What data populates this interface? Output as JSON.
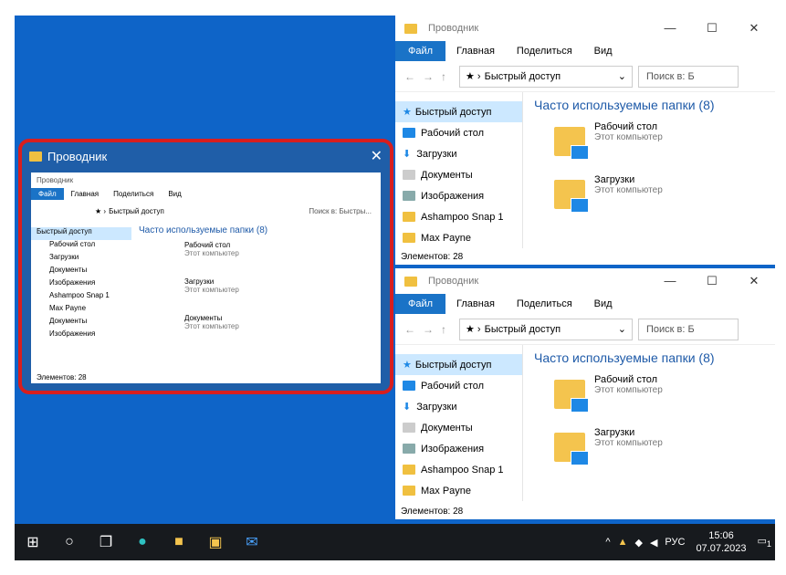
{
  "explorer": {
    "title": "Проводник",
    "ribbon": [
      "Файл",
      "Главная",
      "Поделиться",
      "Вид"
    ],
    "address": "Быстрый доступ",
    "search_placeholder": "Поиск в: Быстрый доступ",
    "search_short": "Поиск в: Б",
    "search_small": "Поиск в: Быстры...",
    "sidebar": [
      "Быстрый доступ",
      "Рабочий стол",
      "Загрузки",
      "Документы",
      "Изображения",
      "Ashampoo Snap 1",
      "Max Payne",
      "Документы",
      "Изображения"
    ],
    "group": "Часто используемые папки (8)",
    "items": [
      {
        "name": "Рабочий стол",
        "sub": "Этот компьютер"
      },
      {
        "name": "Загрузки",
        "sub": "Этот компьютер"
      },
      {
        "name": "Документы",
        "sub": "Этот компьютер"
      }
    ],
    "status": "Элементов: 28"
  },
  "taskbar": {
    "lang": "РУС",
    "time": "15:06",
    "date": "07.07.2023",
    "notifications": "1"
  },
  "colors": {
    "desktop": "#0e64c8",
    "highlight": "#d81e1e"
  }
}
